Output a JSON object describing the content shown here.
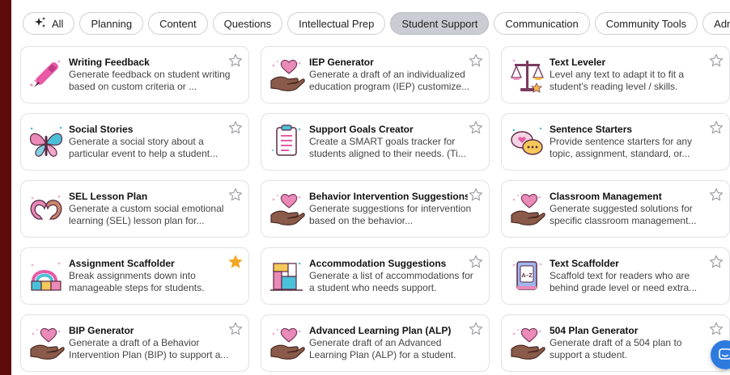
{
  "filters": [
    {
      "label": "All",
      "icon": "sparkle-icon",
      "active": false
    },
    {
      "label": "Planning",
      "active": false
    },
    {
      "label": "Content",
      "active": false
    },
    {
      "label": "Questions",
      "active": false
    },
    {
      "label": "Intellectual Prep",
      "active": false
    },
    {
      "label": "Student Support",
      "active": true
    },
    {
      "label": "Communication",
      "active": false
    },
    {
      "label": "Community Tools",
      "active": false
    },
    {
      "label": "Admin",
      "active": false
    }
  ],
  "tools": [
    {
      "title": "Writing Feedback",
      "description": "Generate feedback on student writing based on custom criteria or ...",
      "icon": "pen-icon",
      "favorited": false
    },
    {
      "title": "IEP Generator",
      "description": "Generate a draft of an individualized education program (IEP) customize...",
      "icon": "hand-heart-icon",
      "favorited": false
    },
    {
      "title": "Text Leveler",
      "description": "Level any text to adapt it to fit a student's reading level / skills.",
      "icon": "scales-icon",
      "favorited": false
    },
    {
      "title": "Social Stories",
      "description": "Generate a social story about a particular event to help a student...",
      "icon": "butterfly-icon",
      "favorited": false
    },
    {
      "title": "Support Goals Creator",
      "description": "Create a SMART goals tracker for students aligned to their needs. (Ti...",
      "icon": "checklist-icon",
      "favorited": false
    },
    {
      "title": "Sentence Starters",
      "description": "Provide sentence starters for any topic, assignment, standard, or...",
      "icon": "speech-bubbles-icon",
      "favorited": false
    },
    {
      "title": "SEL Lesson Plan",
      "description": "Generate a custom social emotional learning (SEL) lesson plan for...",
      "icon": "heart-hands-icon",
      "favorited": false
    },
    {
      "title": "Behavior Intervention Suggestions",
      "description": "Generate suggestions for intervention based on the behavior...",
      "icon": "hand-heart-icon",
      "favorited": false
    },
    {
      "title": "Classroom Management",
      "description": "Generate suggested solutions for specific classroom management...",
      "icon": "hand-heart-icon",
      "favorited": false
    },
    {
      "title": "Assignment Scaffolder",
      "description": "Break assignments down into manageable steps for students.",
      "icon": "rainbow-blocks-icon",
      "favorited": true
    },
    {
      "title": "Accommodation Suggestions",
      "description": "Generate a list of accommodations for a student who needs support.",
      "icon": "building-blocks-icon",
      "favorited": false
    },
    {
      "title": "Text Scaffolder",
      "description": "Scaffold text for readers who are behind grade level or need extra...",
      "icon": "dictionary-icon",
      "favorited": false
    },
    {
      "title": "BIP Generator",
      "description": "Generate a draft of a Behavior Intervention Plan (BIP) to support a...",
      "icon": "hand-heart-icon",
      "favorited": false
    },
    {
      "title": "Advanced Learning Plan (ALP)",
      "description": "Generate draft of an Advanced Learning Plan (ALP) for a student.",
      "icon": "hand-heart-icon",
      "favorited": false
    },
    {
      "title": "504 Plan Generator",
      "description": "Generate draft of a 504 plan to support a student.",
      "icon": "hand-heart-icon",
      "favorited": false
    }
  ],
  "colors": {
    "page_background": "#5c0a0a",
    "active_chip": "#c9ccd2",
    "favorite_star": "#f5a623",
    "help_button": "#2e7be0"
  },
  "help_button": {
    "icon": "chat-icon"
  }
}
